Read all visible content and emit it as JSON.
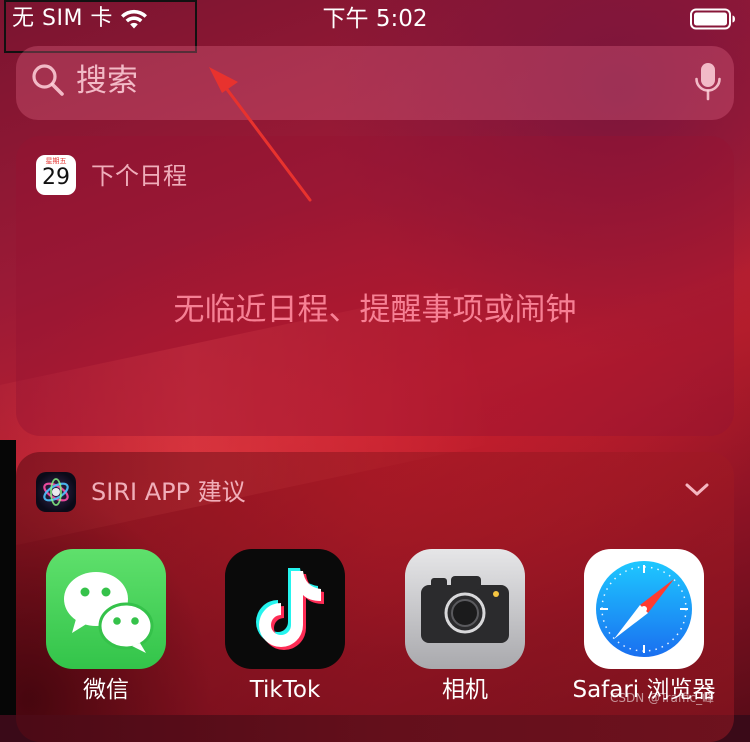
{
  "status_bar": {
    "carrier": "无 SIM 卡",
    "time": "下午 5:02",
    "wifi_icon": "wifi-icon",
    "battery_icon": "battery-icon"
  },
  "search": {
    "placeholder": "搜索",
    "icon": "search-icon",
    "mic_icon": "mic-icon"
  },
  "calendar_widget": {
    "icon_weekday": "星期五",
    "icon_day": "29",
    "title": "下个日程",
    "empty_message": "无临近日程、提醒事项或闹钟"
  },
  "siri_widget": {
    "title": "SIRI APP 建议",
    "apps": [
      {
        "label": "微信",
        "icon": "wechat-icon"
      },
      {
        "label": "TikTok",
        "icon": "tiktok-icon"
      },
      {
        "label": "相机",
        "icon": "camera-icon"
      },
      {
        "label": "Safari 浏览器",
        "icon": "safari-icon"
      }
    ]
  },
  "watermark": "CSDN @Traffic_峰",
  "colors": {
    "wechat_green": "#4cd964",
    "tiktok_cyan": "#25f4ee",
    "tiktok_red": "#fe2c55",
    "annotation_red": "#e8322e"
  }
}
